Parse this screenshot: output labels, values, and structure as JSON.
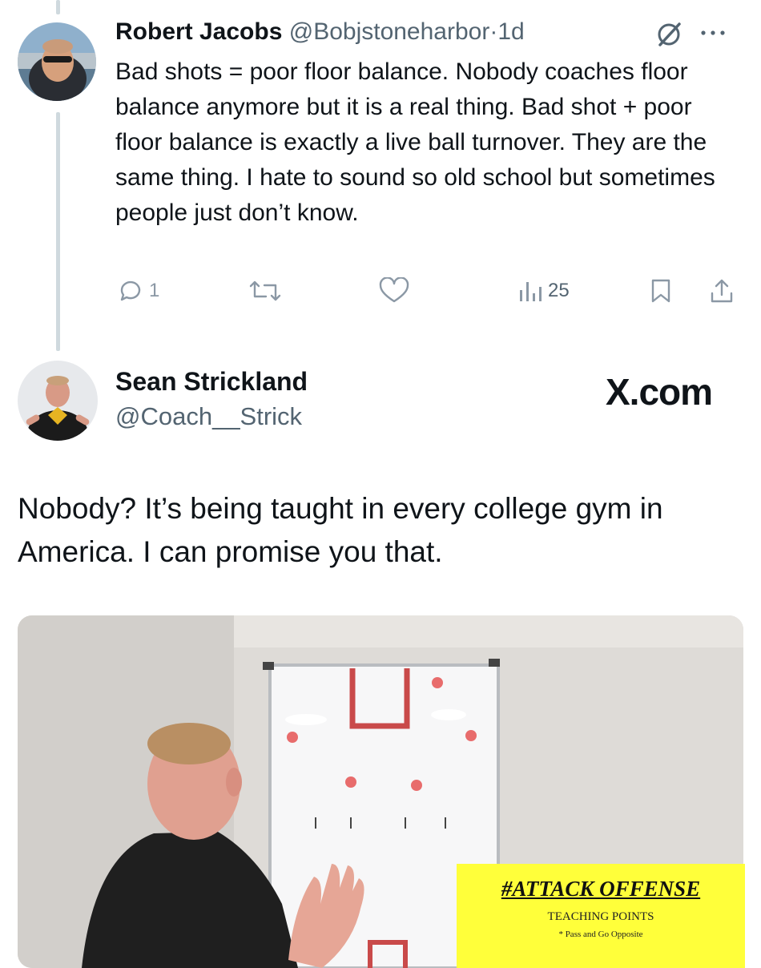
{
  "reply_tweet": {
    "author_name": "Robert Jacobs",
    "author_handle": "@Bobjstoneharbor",
    "separator": "·",
    "time": "1d",
    "text": "Bad shots = poor floor balance. Nobody coaches floor balance anymore but it is a real thing. Bad shot + poor floor balance is exactly a live ball turnover. They are the same thing. I hate to sound so old school but sometimes people just don’t know.",
    "actions": {
      "replies": "1",
      "retweets": "",
      "likes": "",
      "views": "25"
    },
    "icons": {
      "grok": "grok-icon",
      "more": "more-icon",
      "reply": "reply-icon",
      "retweet": "retweet-icon",
      "like": "heart-icon",
      "views": "views-icon",
      "bookmark": "bookmark-icon",
      "share": "share-icon"
    }
  },
  "quoted_tweet": {
    "author_name": "Sean Strickland",
    "author_handle": "@Coach__Strick",
    "brand": "X.com",
    "text": "Nobody? It’s being taught in every college gym in America. I can promise you that.",
    "media": {
      "poster_title": "#ATTACK OFFENSE",
      "poster_subtitle": "TEACHING POINTS",
      "poster_point": "* Pass and Go Opposite"
    }
  },
  "colors": {
    "text": "#0f1419",
    "secondary": "#536471",
    "icon_gray": "#8b98a5",
    "thread_line": "#cfd9de",
    "poster_yellow": "#ffff3a"
  }
}
